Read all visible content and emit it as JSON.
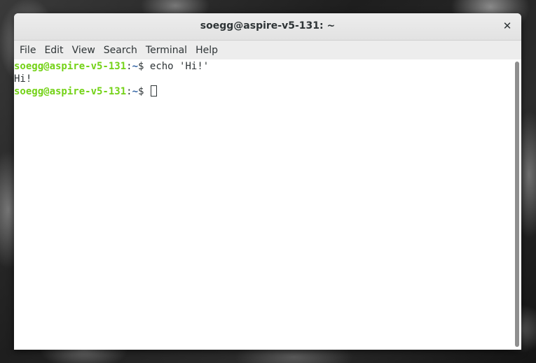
{
  "window": {
    "title": "soegg@aspire-v5-131: ~",
    "close_icon": "close-icon",
    "close_glyph": "✕"
  },
  "menubar": {
    "items": [
      "File",
      "Edit",
      "View",
      "Search",
      "Terminal",
      "Help"
    ]
  },
  "terminal": {
    "lines": [
      {
        "type": "prompt",
        "user": "soegg@aspire-v5-131",
        "sep": ":",
        "path": "~",
        "symbol": "$ ",
        "command": "echo 'Hi!'"
      },
      {
        "type": "output",
        "text": "Hi!"
      },
      {
        "type": "prompt",
        "user": "soegg@aspire-v5-131",
        "sep": ":",
        "path": "~",
        "symbol": "$ ",
        "command": ""
      }
    ]
  },
  "colors": {
    "prompt_user": "#73d216",
    "prompt_path": "#3465a4",
    "text": "#2e3436",
    "background": "#ffffff"
  }
}
